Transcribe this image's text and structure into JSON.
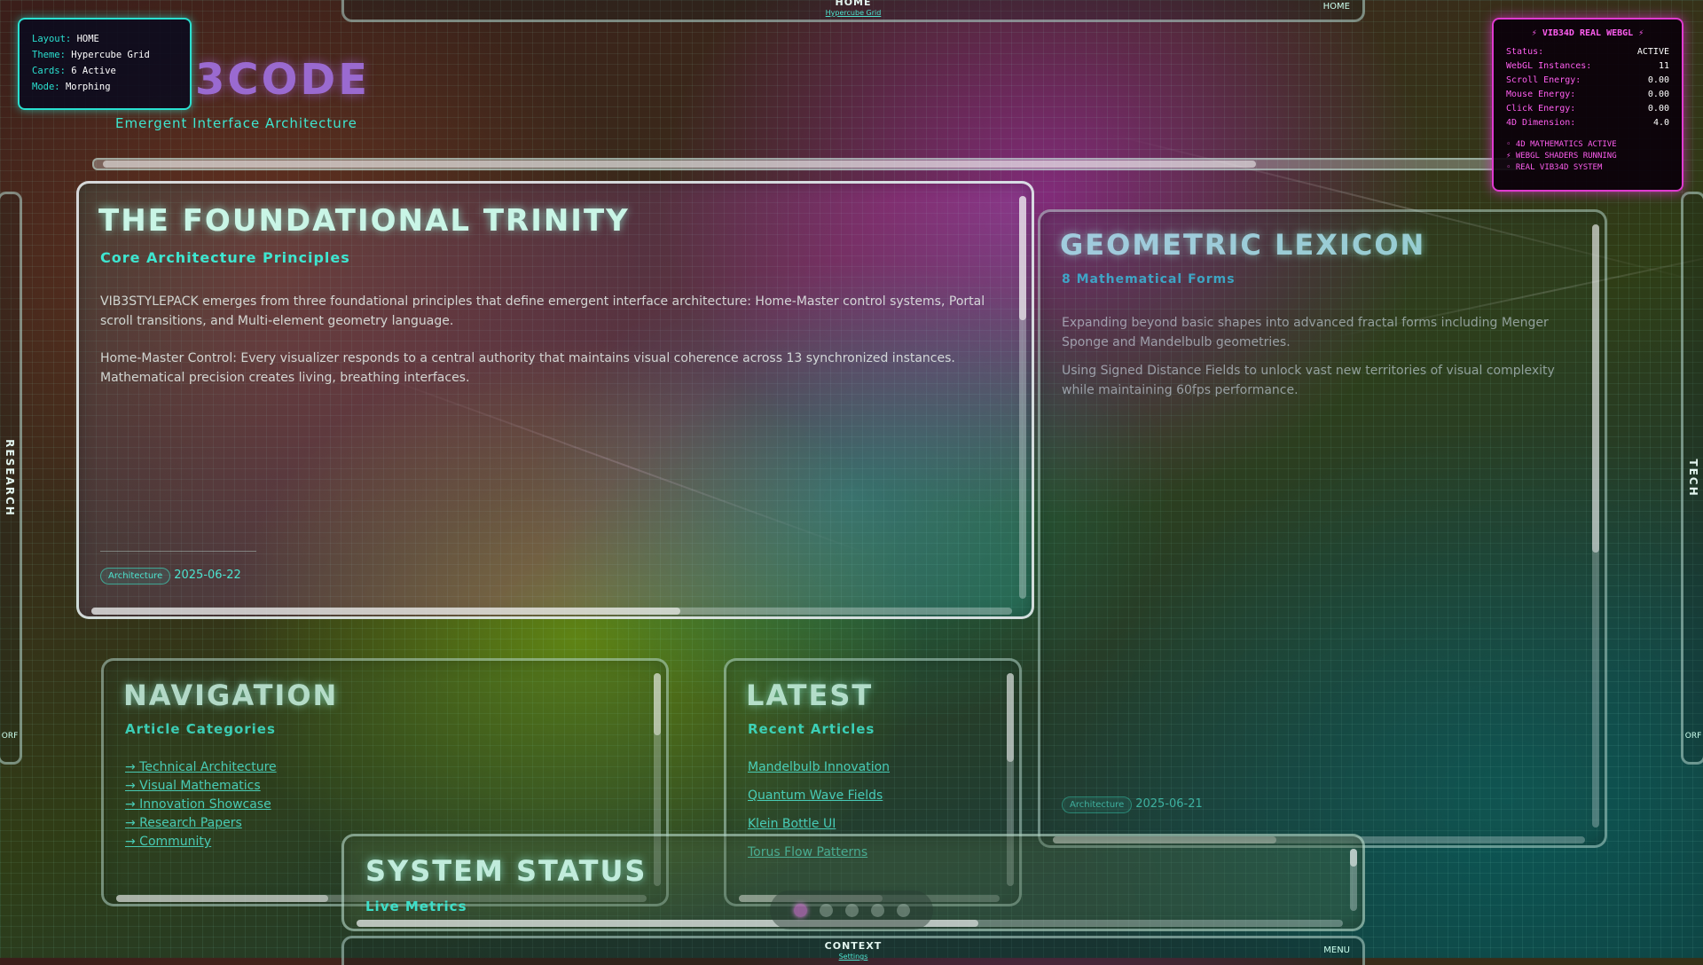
{
  "topbar": {
    "title": "HOME",
    "subtitle": "Hypercube Grid",
    "right_label": "HOME"
  },
  "bottombar": {
    "title": "CONTEXT",
    "subtitle": "Settings",
    "right_label": "MENU"
  },
  "left_tab": {
    "label": "RESEARCH",
    "small": "ORF"
  },
  "right_tab": {
    "label": "TECH",
    "small": "ORF"
  },
  "info": {
    "layout_key": "Layout:",
    "layout_val": "HOME",
    "theme_key": "Theme:",
    "theme_val": "Hypercube Grid",
    "cards_key": "Cards:",
    "cards_val": "6 Active",
    "mode_key": "Mode:",
    "mode_val": "Morphing"
  },
  "webgl": {
    "header": "⚡ VIB34D REAL WEBGL ⚡",
    "rows": [
      {
        "k": "Status:",
        "v": "ACTIVE"
      },
      {
        "k": "WebGL Instances:",
        "v": "11"
      },
      {
        "k": "Scroll Energy:",
        "v": "0.00"
      },
      {
        "k": "Mouse Energy:",
        "v": "0.00"
      },
      {
        "k": "Click Energy:",
        "v": "0.00"
      },
      {
        "k": "4D Dimension:",
        "v": "4.0"
      }
    ],
    "notes": [
      "◦ 4D MATHEMATICS ACTIVE",
      "⚡ WEBGL SHADERS RUNNING",
      "◦ REAL VIB34D SYSTEM"
    ]
  },
  "brand": {
    "logo": "3CODE",
    "tagline": "Emergent Interface Architecture"
  },
  "trinity": {
    "title": "THE FOUNDATIONAL TRINITY",
    "subtitle": "Core Architecture Principles",
    "p1": "VIB3STYLEPACK emerges from three foundational principles that define emergent interface architecture: Home-Master control systems, Portal scroll transitions, and Multi-element geometry language.",
    "p2": "Home-Master Control: Every visualizer responds to a central authority that maintains visual coherence across 13 synchronized instances. Mathematical precision creates living, breathing interfaces.",
    "tag": "Architecture",
    "date": "2025-06-22"
  },
  "lexicon": {
    "title": "GEOMETRIC LEXICON",
    "subtitle": "8 Mathematical Forms",
    "p1": "Expanding beyond basic shapes into advanced fractal forms including Menger Sponge and Mandelbulb geometries.",
    "p2": "Using Signed Distance Fields to unlock vast new territories of visual complexity while maintaining 60fps performance.",
    "tag": "Architecture",
    "date": "2025-06-21"
  },
  "nav": {
    "title": "NAVIGATION",
    "subtitle": "Article Categories",
    "items": [
      "→ Technical Architecture",
      "→ Visual Mathematics",
      "→ Innovation Showcase",
      "→ Research Papers",
      "→ Community"
    ]
  },
  "latest": {
    "title": "LATEST",
    "subtitle": "Recent Articles",
    "items": [
      "Mandelbulb Innovation",
      "Quantum Wave Fields",
      "Klein Bottle UI",
      "Torus Flow Patterns"
    ]
  },
  "status": {
    "title": "SYSTEM STATUS",
    "subtitle": "Live Metrics"
  },
  "pager": {
    "count": 5,
    "active": 1
  }
}
